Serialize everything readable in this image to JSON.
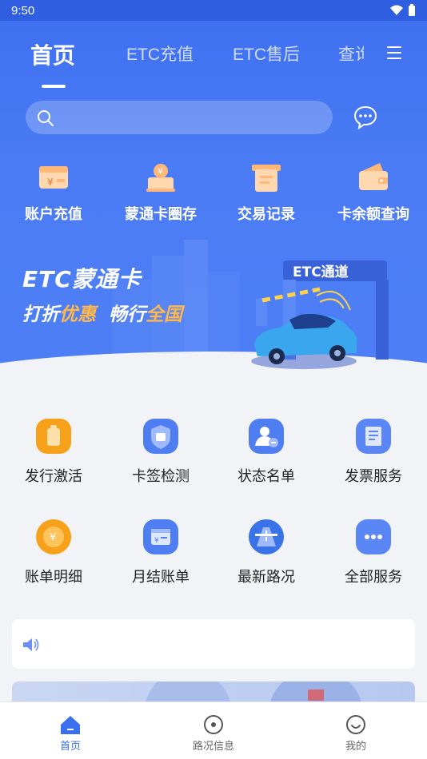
{
  "status_bar": {
    "time": "9:50"
  },
  "tabs": [
    {
      "label": "首页",
      "active": true
    },
    {
      "label": "ETC充值"
    },
    {
      "label": "ETC售后"
    },
    {
      "label": "查询"
    }
  ],
  "search": {
    "placeholder": ""
  },
  "quick_actions": [
    {
      "label": "账户充值",
      "icon": "wallet-card-icon"
    },
    {
      "label": "蒙通卡圈存",
      "icon": "card-deposit-icon"
    },
    {
      "label": "交易记录",
      "icon": "transaction-record-icon"
    },
    {
      "label": "卡余额查询",
      "icon": "balance-wallet-icon"
    }
  ],
  "banner": {
    "title": "ETC蒙通卡",
    "sub_part1": "打折",
    "sub_hl1": "优惠",
    "sub_part2": "畅行",
    "sub_hl2": "全国",
    "gate_label": "ETC通道"
  },
  "services": [
    {
      "label": "发行激活",
      "icon": "issue-activate-icon",
      "color": "#f7a11a"
    },
    {
      "label": "卡签检测",
      "icon": "card-tag-check-icon",
      "color": "#4f7ef2"
    },
    {
      "label": "状态名单",
      "icon": "status-list-icon",
      "color": "#4f7ef2"
    },
    {
      "label": "发票服务",
      "icon": "invoice-icon",
      "color": "#5b86f5"
    },
    {
      "label": "账单明细",
      "icon": "bill-detail-icon",
      "color": "#f7a11a"
    },
    {
      "label": "月结账单",
      "icon": "monthly-bill-icon",
      "color": "#4f7ef2"
    },
    {
      "label": "最新路况",
      "icon": "road-condition-icon",
      "color": "#3a72e8"
    },
    {
      "label": "全部服务",
      "icon": "more-services-icon",
      "color": "#5b86f5"
    }
  ],
  "bottom_nav": [
    {
      "label": "首页",
      "icon": "home-icon",
      "active": true
    },
    {
      "label": "路况信息",
      "icon": "road-info-icon"
    },
    {
      "label": "我的",
      "icon": "profile-icon"
    }
  ],
  "colors": {
    "primary": "#3e6ff0",
    "accent": "#f7a11a",
    "background": "#f2f3f6"
  }
}
